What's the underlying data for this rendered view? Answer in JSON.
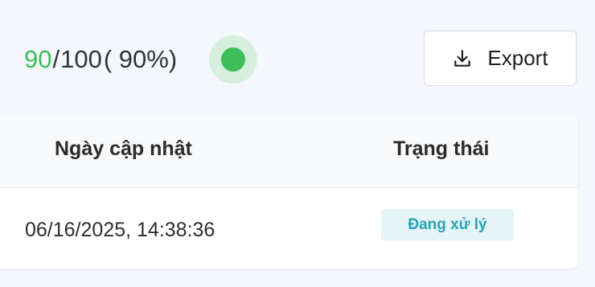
{
  "score": {
    "obtained": "90",
    "separator": "/",
    "total": "100",
    "percent": "( 90%)"
  },
  "status_indicator": {
    "color": "#3cbf58"
  },
  "toolbar": {
    "export_label": "Export",
    "export_icon": "download-icon"
  },
  "table": {
    "headers": {
      "updated_date": "Ngày cập nhật",
      "status": "Trạng thái"
    },
    "rows": [
      {
        "updated_date": "06/16/2025, 14:38:36",
        "status": "Đang xử lý"
      }
    ]
  }
}
